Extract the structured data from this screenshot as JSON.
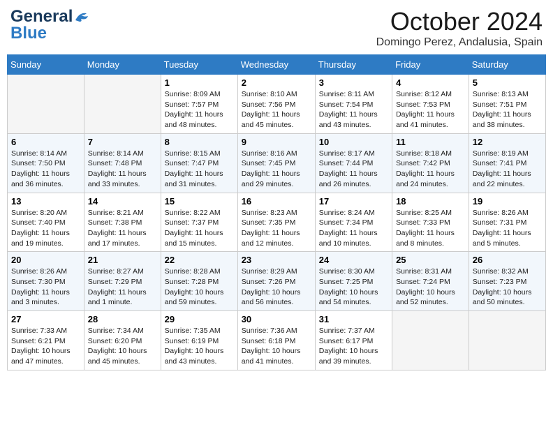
{
  "header": {
    "logo_line1": "General",
    "logo_line2": "Blue",
    "month": "October 2024",
    "location": "Domingo Perez, Andalusia, Spain"
  },
  "days_of_week": [
    "Sunday",
    "Monday",
    "Tuesday",
    "Wednesday",
    "Thursday",
    "Friday",
    "Saturday"
  ],
  "weeks": [
    [
      {
        "day": "",
        "info": ""
      },
      {
        "day": "",
        "info": ""
      },
      {
        "day": "1",
        "info": "Sunrise: 8:09 AM\nSunset: 7:57 PM\nDaylight: 11 hours and 48 minutes."
      },
      {
        "day": "2",
        "info": "Sunrise: 8:10 AM\nSunset: 7:56 PM\nDaylight: 11 hours and 45 minutes."
      },
      {
        "day": "3",
        "info": "Sunrise: 8:11 AM\nSunset: 7:54 PM\nDaylight: 11 hours and 43 minutes."
      },
      {
        "day": "4",
        "info": "Sunrise: 8:12 AM\nSunset: 7:53 PM\nDaylight: 11 hours and 41 minutes."
      },
      {
        "day": "5",
        "info": "Sunrise: 8:13 AM\nSunset: 7:51 PM\nDaylight: 11 hours and 38 minutes."
      }
    ],
    [
      {
        "day": "6",
        "info": "Sunrise: 8:14 AM\nSunset: 7:50 PM\nDaylight: 11 hours and 36 minutes."
      },
      {
        "day": "7",
        "info": "Sunrise: 8:14 AM\nSunset: 7:48 PM\nDaylight: 11 hours and 33 minutes."
      },
      {
        "day": "8",
        "info": "Sunrise: 8:15 AM\nSunset: 7:47 PM\nDaylight: 11 hours and 31 minutes."
      },
      {
        "day": "9",
        "info": "Sunrise: 8:16 AM\nSunset: 7:45 PM\nDaylight: 11 hours and 29 minutes."
      },
      {
        "day": "10",
        "info": "Sunrise: 8:17 AM\nSunset: 7:44 PM\nDaylight: 11 hours and 26 minutes."
      },
      {
        "day": "11",
        "info": "Sunrise: 8:18 AM\nSunset: 7:42 PM\nDaylight: 11 hours and 24 minutes."
      },
      {
        "day": "12",
        "info": "Sunrise: 8:19 AM\nSunset: 7:41 PM\nDaylight: 11 hours and 22 minutes."
      }
    ],
    [
      {
        "day": "13",
        "info": "Sunrise: 8:20 AM\nSunset: 7:40 PM\nDaylight: 11 hours and 19 minutes."
      },
      {
        "day": "14",
        "info": "Sunrise: 8:21 AM\nSunset: 7:38 PM\nDaylight: 11 hours and 17 minutes."
      },
      {
        "day": "15",
        "info": "Sunrise: 8:22 AM\nSunset: 7:37 PM\nDaylight: 11 hours and 15 minutes."
      },
      {
        "day": "16",
        "info": "Sunrise: 8:23 AM\nSunset: 7:35 PM\nDaylight: 11 hours and 12 minutes."
      },
      {
        "day": "17",
        "info": "Sunrise: 8:24 AM\nSunset: 7:34 PM\nDaylight: 11 hours and 10 minutes."
      },
      {
        "day": "18",
        "info": "Sunrise: 8:25 AM\nSunset: 7:33 PM\nDaylight: 11 hours and 8 minutes."
      },
      {
        "day": "19",
        "info": "Sunrise: 8:26 AM\nSunset: 7:31 PM\nDaylight: 11 hours and 5 minutes."
      }
    ],
    [
      {
        "day": "20",
        "info": "Sunrise: 8:26 AM\nSunset: 7:30 PM\nDaylight: 11 hours and 3 minutes."
      },
      {
        "day": "21",
        "info": "Sunrise: 8:27 AM\nSunset: 7:29 PM\nDaylight: 11 hours and 1 minute."
      },
      {
        "day": "22",
        "info": "Sunrise: 8:28 AM\nSunset: 7:28 PM\nDaylight: 10 hours and 59 minutes."
      },
      {
        "day": "23",
        "info": "Sunrise: 8:29 AM\nSunset: 7:26 PM\nDaylight: 10 hours and 56 minutes."
      },
      {
        "day": "24",
        "info": "Sunrise: 8:30 AM\nSunset: 7:25 PM\nDaylight: 10 hours and 54 minutes."
      },
      {
        "day": "25",
        "info": "Sunrise: 8:31 AM\nSunset: 7:24 PM\nDaylight: 10 hours and 52 minutes."
      },
      {
        "day": "26",
        "info": "Sunrise: 8:32 AM\nSunset: 7:23 PM\nDaylight: 10 hours and 50 minutes."
      }
    ],
    [
      {
        "day": "27",
        "info": "Sunrise: 7:33 AM\nSunset: 6:21 PM\nDaylight: 10 hours and 47 minutes."
      },
      {
        "day": "28",
        "info": "Sunrise: 7:34 AM\nSunset: 6:20 PM\nDaylight: 10 hours and 45 minutes."
      },
      {
        "day": "29",
        "info": "Sunrise: 7:35 AM\nSunset: 6:19 PM\nDaylight: 10 hours and 43 minutes."
      },
      {
        "day": "30",
        "info": "Sunrise: 7:36 AM\nSunset: 6:18 PM\nDaylight: 10 hours and 41 minutes."
      },
      {
        "day": "31",
        "info": "Sunrise: 7:37 AM\nSunset: 6:17 PM\nDaylight: 10 hours and 39 minutes."
      },
      {
        "day": "",
        "info": ""
      },
      {
        "day": "",
        "info": ""
      }
    ]
  ]
}
